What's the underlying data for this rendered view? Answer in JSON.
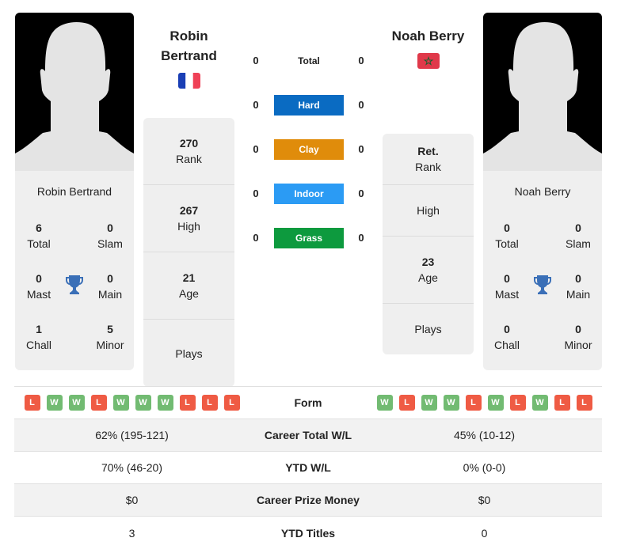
{
  "colors": {
    "hard": "#0a6bc2",
    "clay": "#e08c0b",
    "indoor": "#2b9bf4",
    "grass": "#0d9a3e",
    "win": "#72bb72",
    "loss": "#ef5b44",
    "trophy": "#3a6fb7"
  },
  "player1": {
    "name_line1": "Robin",
    "name_line2": "Bertrand",
    "card_name": "Robin Bertrand",
    "flag": "france-flag",
    "titles": {
      "total": "6",
      "total_label": "Total",
      "slam": "0",
      "slam_label": "Slam",
      "mast": "0",
      "mast_label": "Mast",
      "main": "0",
      "main_label": "Main",
      "chall": "1",
      "chall_label": "Chall",
      "minor": "5",
      "minor_label": "Minor"
    },
    "rank": "270",
    "rank_label": "Rank",
    "high": "267",
    "high_label": "High",
    "age": "21",
    "age_label": "Age",
    "plays_label": "Plays",
    "form": [
      "L",
      "W",
      "W",
      "L",
      "W",
      "W",
      "W",
      "L",
      "L",
      "L"
    ]
  },
  "player2": {
    "name": "Noah Berry",
    "card_name": "Noah Berry",
    "flag": "morocco-flag",
    "titles": {
      "total": "0",
      "total_label": "Total",
      "slam": "0",
      "slam_label": "Slam",
      "mast": "0",
      "mast_label": "Mast",
      "main": "0",
      "main_label": "Main",
      "chall": "0",
      "chall_label": "Chall",
      "minor": "0",
      "minor_label": "Minor"
    },
    "rank": "Ret.",
    "rank_label": "Rank",
    "high_label": "High",
    "age": "23",
    "age_label": "Age",
    "plays_label": "Plays",
    "form": [
      "W",
      "L",
      "W",
      "W",
      "L",
      "W",
      "L",
      "W",
      "L",
      "L"
    ]
  },
  "surfaces": [
    {
      "label": "Total",
      "p1": "0",
      "p2": "0"
    },
    {
      "label": "Hard",
      "p1": "0",
      "p2": "0"
    },
    {
      "label": "Clay",
      "p1": "0",
      "p2": "0"
    },
    {
      "label": "Indoor",
      "p1": "0",
      "p2": "0"
    },
    {
      "label": "Grass",
      "p1": "0",
      "p2": "0"
    }
  ],
  "table": {
    "form_label": "Form",
    "rows": [
      {
        "label": "Career Total W/L",
        "p1": "62% (195-121)",
        "p2": "45% (10-12)"
      },
      {
        "label": "YTD W/L",
        "p1": "70% (46-20)",
        "p2": "0% (0-0)"
      },
      {
        "label": "Career Prize Money",
        "p1": "$0",
        "p2": "$0"
      },
      {
        "label": "YTD Titles",
        "p1": "3",
        "p2": "0"
      }
    ]
  }
}
